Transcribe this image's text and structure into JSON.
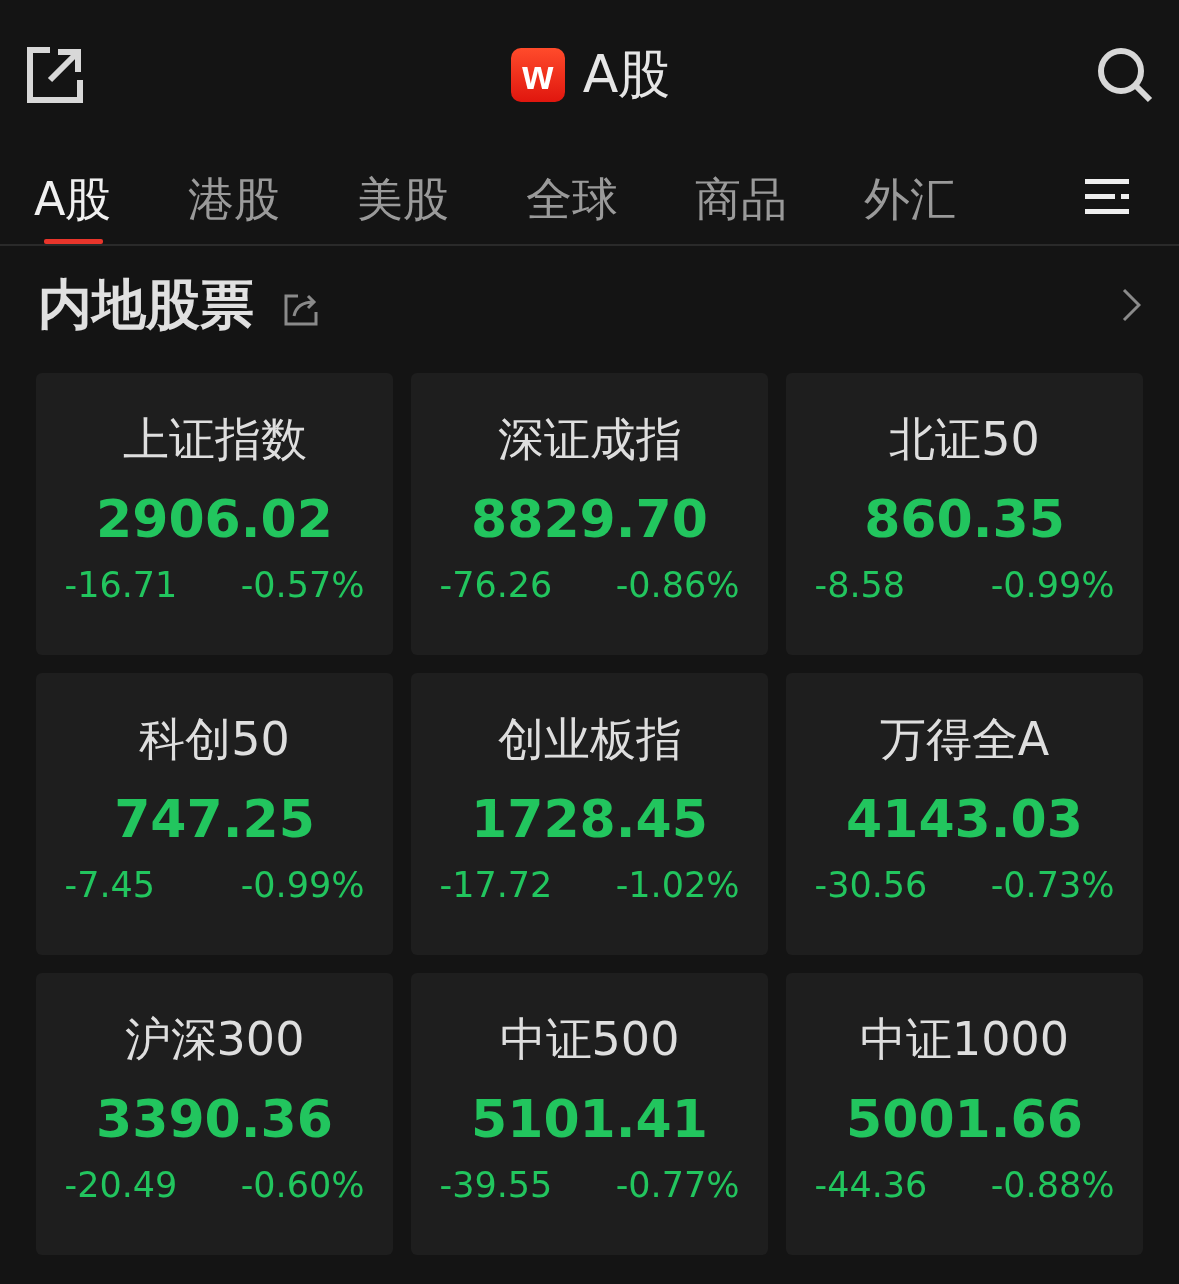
{
  "header": {
    "logo": "w",
    "title": "A股"
  },
  "tabs": [
    {
      "label": "A股",
      "selected": true
    },
    {
      "label": "港股",
      "selected": false
    },
    {
      "label": "美股",
      "selected": false
    },
    {
      "label": "全球",
      "selected": false
    },
    {
      "label": "商品",
      "selected": false
    },
    {
      "label": "外汇",
      "selected": false
    }
  ],
  "section": {
    "title": "内地股票"
  },
  "indices": [
    {
      "name": "上证指数",
      "price": "2906.02",
      "change": "-16.71",
      "percent": "-0.57%",
      "color": "#22c55e"
    },
    {
      "name": "深证成指",
      "price": "8829.70",
      "change": "-76.26",
      "percent": "-0.86%",
      "color": "#22c55e"
    },
    {
      "name": "北证50",
      "price": "860.35",
      "change": "-8.58",
      "percent": "-0.99%",
      "color": "#22c55e"
    },
    {
      "name": "科创50",
      "price": "747.25",
      "change": "-7.45",
      "percent": "-0.99%",
      "color": "#22c55e"
    },
    {
      "name": "创业板指",
      "price": "1728.45",
      "change": "-17.72",
      "percent": "-1.02%",
      "color": "#22c55e"
    },
    {
      "name": "万得全A",
      "price": "4143.03",
      "change": "-30.56",
      "percent": "-0.73%",
      "color": "#22c55e"
    },
    {
      "name": "沪深300",
      "price": "3390.36",
      "change": "-20.49",
      "percent": "-0.60%",
      "color": "#22c55e"
    },
    {
      "name": "中证500",
      "price": "5101.41",
      "change": "-39.55",
      "percent": "-0.77%",
      "color": "#22c55e"
    },
    {
      "name": "中证1000",
      "price": "5001.66",
      "change": "-44.36",
      "percent": "-0.88%",
      "color": "#22c55e"
    }
  ]
}
